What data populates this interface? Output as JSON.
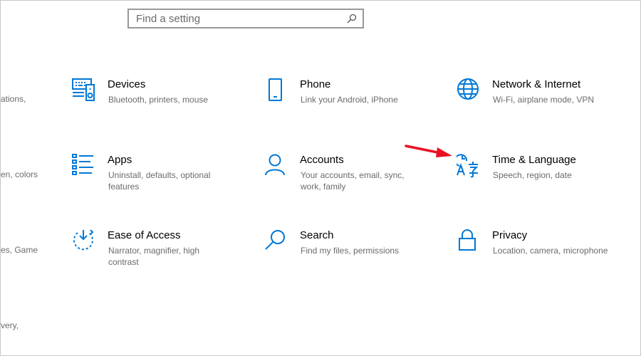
{
  "search": {
    "placeholder": "Find a setting",
    "icon": "search-icon"
  },
  "left_cut": [
    "ations,",
    "en, colors",
    "es, Game",
    "very,"
  ],
  "tiles": [
    {
      "title": "Devices",
      "desc": "Bluetooth, printers, mouse",
      "icon": "devices-icon"
    },
    {
      "title": "Phone",
      "desc": "Link your Android, iPhone",
      "icon": "phone-icon"
    },
    {
      "title": "Network & Internet",
      "desc": "Wi-Fi, airplane mode, VPN",
      "icon": "globe-icon"
    },
    {
      "title": "Apps",
      "desc": "Uninstall, defaults, optional features",
      "icon": "apps-list-icon"
    },
    {
      "title": "Accounts",
      "desc": "Your accounts, email, sync, work, family",
      "icon": "person-icon"
    },
    {
      "title": "Time & Language",
      "desc": "Speech, region, date",
      "icon": "time-language-icon"
    },
    {
      "title": "Ease of Access",
      "desc": "Narrator, magnifier, high contrast",
      "icon": "ease-of-access-icon"
    },
    {
      "title": "Search",
      "desc": "Find my files, permissions",
      "icon": "magnifier-icon"
    },
    {
      "title": "Privacy",
      "desc": "Location, camera, microphone",
      "icon": "lock-icon"
    }
  ],
  "colors": {
    "accent": "#0078d7",
    "annotation_arrow": "#e81123",
    "desc_text": "#6b6b6b"
  }
}
